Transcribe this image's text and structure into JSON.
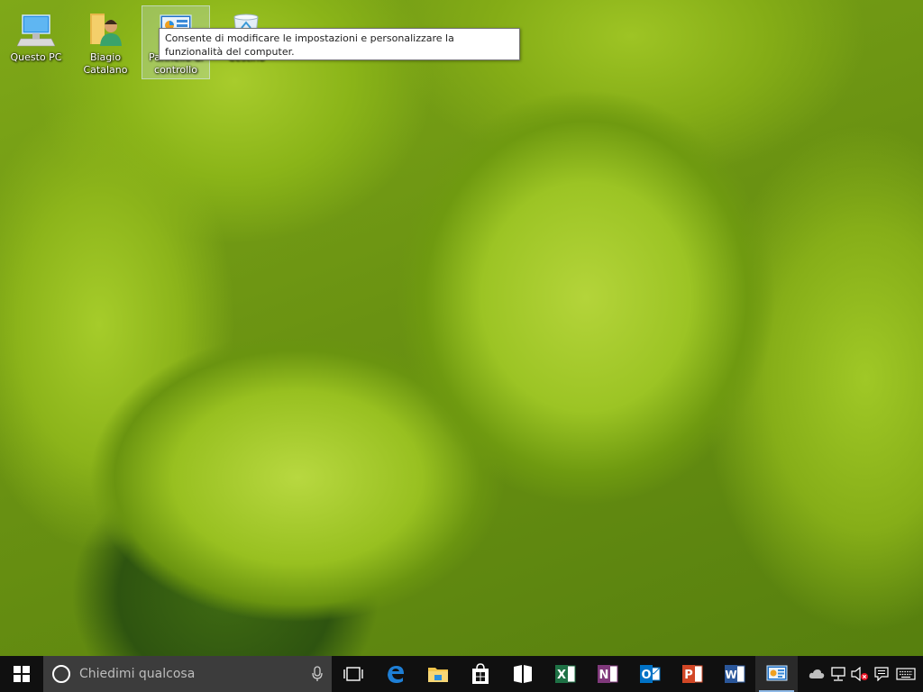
{
  "desktop": {
    "icons": [
      {
        "label": "Questo PC",
        "icon": "computer-icon"
      },
      {
        "label": "Biagio Catalano",
        "icon": "user-folder-icon"
      },
      {
        "label": "Pannello di controllo",
        "icon": "control-panel-icon"
      },
      {
        "label": "Cestino",
        "icon": "recycle-bin-icon"
      }
    ],
    "tooltip": "Consente di modificare le impostazioni e personalizzare la funzionalità del computer."
  },
  "taskbar": {
    "search_placeholder": "Chiedimi qualcosa",
    "apps": [
      {
        "name": "task-view",
        "icon": "task-view-icon"
      },
      {
        "name": "edge",
        "icon": "edge-icon",
        "letter": "e",
        "color": "#1e7fd6"
      },
      {
        "name": "file-explorer",
        "icon": "folder-icon",
        "color": "#f2c54b"
      },
      {
        "name": "store",
        "icon": "store-icon"
      },
      {
        "name": "tablet",
        "icon": "tablet-mode-icon"
      },
      {
        "name": "excel",
        "icon": "excel-icon",
        "letter": "X",
        "color": "#1e7145"
      },
      {
        "name": "onenote",
        "icon": "onenote-icon",
        "letter": "N",
        "color": "#80397b"
      },
      {
        "name": "outlook",
        "icon": "outlook-icon",
        "letter": "O",
        "color": "#0072c6"
      },
      {
        "name": "powerpoint",
        "icon": "powerpoint-icon",
        "letter": "P",
        "color": "#d24726"
      },
      {
        "name": "word",
        "icon": "word-icon",
        "letter": "W",
        "color": "#2b579a"
      },
      {
        "name": "control-panel",
        "icon": "control-panel-icon"
      }
    ],
    "tray": [
      "onedrive-icon",
      "network-icon",
      "volume-muted-icon",
      "notifications-icon",
      "keyboard-icon"
    ]
  }
}
